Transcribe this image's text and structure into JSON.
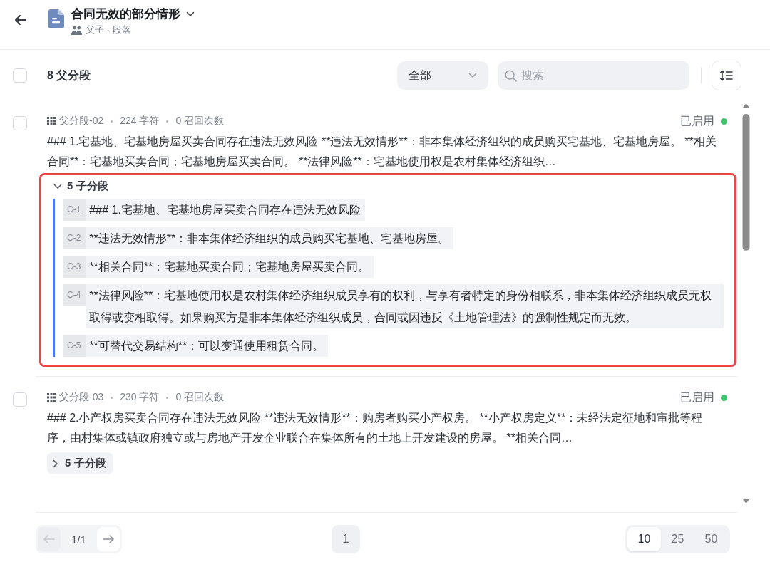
{
  "header": {
    "title": "合同无效的部分情形",
    "subtitle": "父子 · 段落"
  },
  "toolbar": {
    "select_all_checked": false,
    "count_label": "8 父分段",
    "filter": {
      "value": "全部"
    },
    "search": {
      "placeholder": "搜索"
    }
  },
  "segments": [
    {
      "checked": false,
      "id_label": "父分段-02",
      "chars": "224 字符",
      "recalls": "0 召回次数",
      "status": "已启用",
      "enabled": true,
      "text": "### 1.宅基地、宅基地房屋买卖合同存在违法无效风险 **违法无效情形**：非本集体经济组织的成员购买宅基地、宅基地房屋。 **相关合同**：宅基地买卖合同；宅基地房屋买卖合同。 **法律风险**：宅基地使用权是农村集体经济组织…",
      "children_label": "5 子分段",
      "expanded": true,
      "highlighted": true,
      "children": [
        {
          "tag": "C-1",
          "text": "### 1.宅基地、宅基地房屋买卖合同存在违法无效风险"
        },
        {
          "tag": "C-2",
          "text": "**违法无效情形**：非本集体经济组织的成员购买宅基地、宅基地房屋。"
        },
        {
          "tag": "C-3",
          "text": "**相关合同**：宅基地买卖合同；宅基地房屋买卖合同。"
        },
        {
          "tag": "C-4",
          "text": "**法律风险**：宅基地使用权是农村集体经济组织成员享有的权利，与享有者特定的身份相联系，非本集体经济组织成员无权取得或变相取得。如果购买方是非本集体经济组织成员，合同或因违反《土地管理法》的强制性规定而无效。"
        },
        {
          "tag": "C-5",
          "text": "**可替代交易结构**：可以变通使用租赁合同。"
        }
      ]
    },
    {
      "checked": false,
      "id_label": "父分段-03",
      "chars": "230 字符",
      "recalls": "0 召回次数",
      "status": "已启用",
      "enabled": true,
      "text": "### 2.小产权房买卖合同存在违法无效风险 **违法无效情形**：购房者购买小产权房。 **小产权房定义**：未经法定征地和审批等程序，由村集体或镇政府独立或与房地产开发企业联合在集体所有的土地上开发建设的房屋。 **相关合同…",
      "children_label": "5 子分段",
      "expanded": false,
      "highlighted": false
    }
  ],
  "pagination": {
    "prev": {
      "disabled": true
    },
    "page_info": "1/1",
    "next": {
      "disabled": false
    },
    "pages": [
      {
        "label": "1",
        "selected": true
      }
    ],
    "page_sizes": [
      {
        "label": "10",
        "selected": true
      },
      {
        "label": "25",
        "selected": false
      },
      {
        "label": "50",
        "selected": false
      }
    ]
  }
}
